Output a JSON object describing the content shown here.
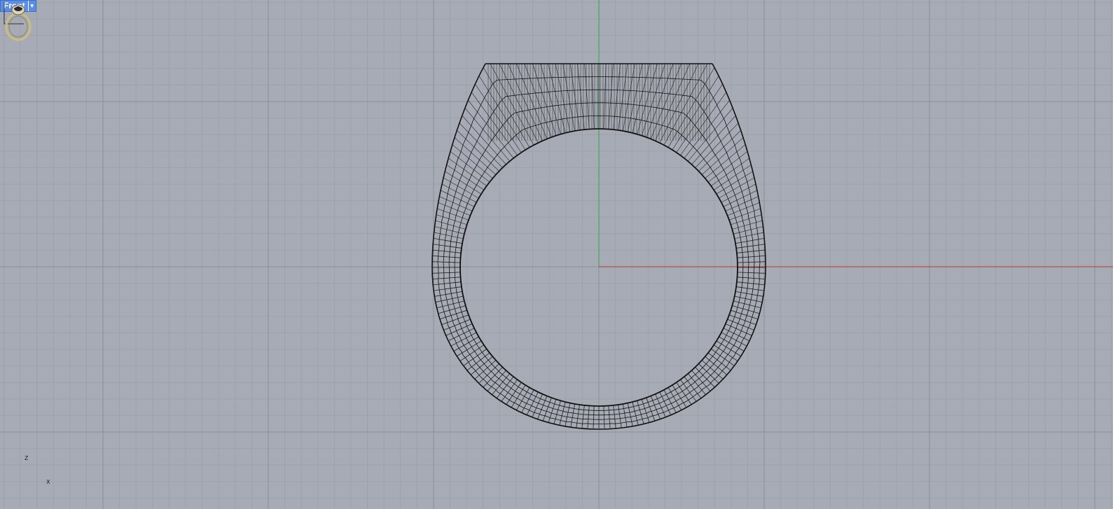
{
  "viewport": {
    "title": "Front",
    "colors": {
      "background": "#a7abb5",
      "grid_minor": "#9da1ab",
      "grid_major": "#8b8f99",
      "x_axis": "#b5382b",
      "z_axis": "#2ea83a",
      "wire": "#111111"
    }
  },
  "cplane_axes": {
    "vertical": "Z",
    "horizontal": "X"
  },
  "icons": {
    "menu": "chevron-down-icon",
    "navigation": "ring-preview-icon"
  }
}
